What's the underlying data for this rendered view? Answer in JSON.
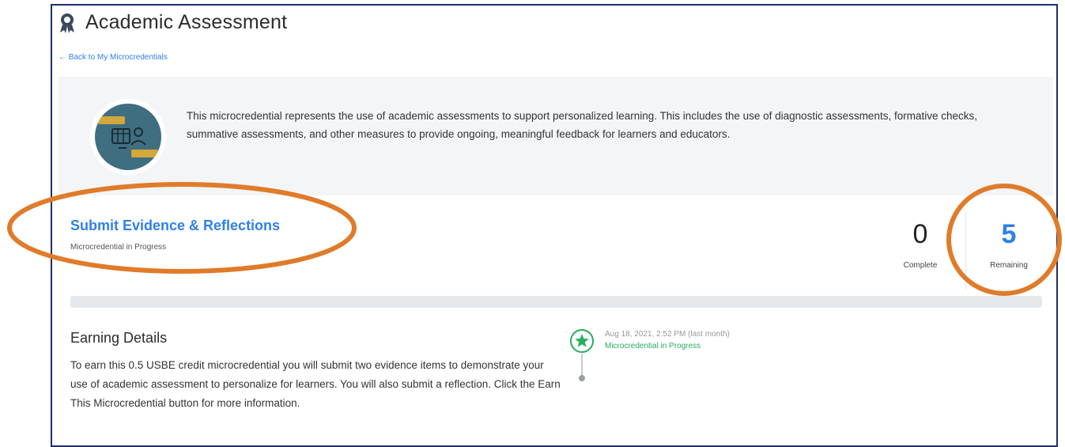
{
  "header": {
    "title": "Academic Assessment",
    "icon": "award-ribbon-icon",
    "back_link": "← Back to My Microcredentials"
  },
  "description": {
    "badge_icon": "microcredential-badge-icon",
    "text": "This microcredential represents the use of academic assessments to support personalized learning. This includes the use of diagnostic assessments, formative checks, summative assessments, and other measures to provide ongoing, meaningful feedback for learners and educators."
  },
  "progress_section": {
    "title": "Submit Evidence & Reflections",
    "subtitle": "Microcredential in Progress",
    "complete": {
      "value": "0",
      "label": "Complete"
    },
    "remaining": {
      "value": "5",
      "label": "Remaining"
    },
    "progress_fraction": 0
  },
  "earning": {
    "title": "Earning Details",
    "text": "To earn this 0.5 USBE credit microcredential you will submit two evidence items to demonstrate your use of academic assessment to personalize for learners. You will also submit a reflection. Click the Earn This Microcredential button for more information."
  },
  "timeline": {
    "icon": "star-icon",
    "date": "Aug 18, 2021, 2:52 PM (last month)",
    "status": "Microcredential in Progress"
  },
  "colors": {
    "accent": "#2f80ed",
    "annotation": "#e07b2a",
    "success": "#27ae60",
    "frame": "#1f2d6b",
    "panel": "#f3f5f7"
  }
}
